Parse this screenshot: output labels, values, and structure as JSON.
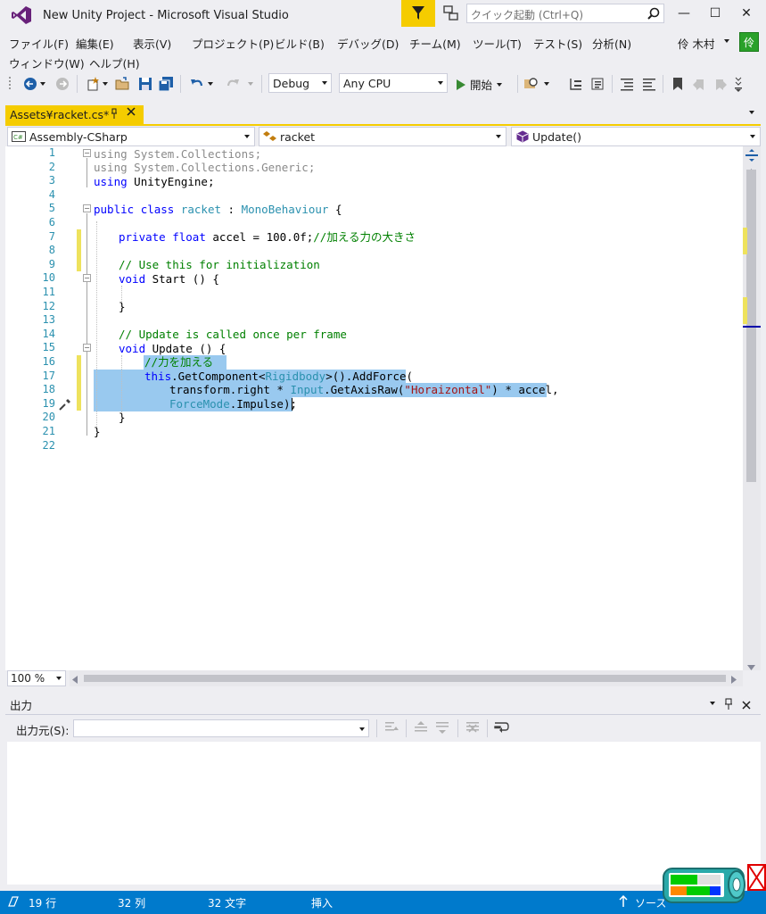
{
  "window": {
    "title": "New Unity Project - Microsoft Visual Studio",
    "quick_launch_placeholder": "クイック起動 (Ctrl+Q)",
    "minimize_glyph": "—",
    "maximize_glyph": "☐",
    "close_glyph": "✕"
  },
  "menu": {
    "items": [
      "ファイル(F)",
      "編集(E)",
      "表示(V)",
      "プロジェクト(P)",
      "ビルド(B)",
      "デバッグ(D)",
      "チーム(M)",
      "ツール(T)",
      "テスト(S)",
      "分析(N)",
      "ウィンドウ(W)",
      "ヘルプ(H)"
    ],
    "user_name": "伶 木村",
    "user_avatar_letter": "伶"
  },
  "toolbar": {
    "config": "Debug",
    "platform": "Any CPU",
    "start_label": "開始"
  },
  "tab": {
    "label": "Assets¥racket.cs*"
  },
  "navbar": {
    "project": "Assembly-CSharp",
    "type": "racket",
    "member": "Update()"
  },
  "editor": {
    "zoom": "100 %",
    "line_numbers": [
      "1",
      "2",
      "3",
      "4",
      "5",
      "6",
      "7",
      "8",
      "9",
      "10",
      "11",
      "12",
      "13",
      "14",
      "15",
      "16",
      "17",
      "18",
      "19",
      "20",
      "21",
      "22"
    ]
  },
  "code": {
    "l1": [
      "using",
      " System.Collections;"
    ],
    "l2": [
      "using",
      " System.Collections.Generic;"
    ],
    "l3": [
      "using",
      " UnityEngine;"
    ],
    "l5": [
      "public",
      " ",
      "class",
      " ",
      "racket",
      " : ",
      "MonoBehaviour",
      " {"
    ],
    "l7": [
      "private",
      " ",
      "float",
      " accel = 100.0f;",
      "//加える力の大きさ"
    ],
    "l9": [
      "// Use this for initialization"
    ],
    "l10": [
      "void",
      " Start () {"
    ],
    "l12": [
      "}"
    ],
    "l14": [
      "// Update is called once per frame"
    ],
    "l15": [
      "void",
      " Update () {"
    ],
    "l16": [
      "//力を加える"
    ],
    "l17": [
      "this",
      ".GetComponent<",
      "Rigidbody",
      ">().AddForce("
    ],
    "l18": [
      "transform.right * ",
      "Input",
      ".GetAxisRaw(",
      "\"Horaizontal\"",
      ") * accel,"
    ],
    "l19": [
      "ForceMode",
      ".Impulse);"
    ],
    "l20": [
      "}"
    ],
    "l21": [
      "}"
    ]
  },
  "output": {
    "title": "出力",
    "source_label": "出力元(S):",
    "source_value": ""
  },
  "status": {
    "line": "19 行",
    "col": "32 列",
    "char": "32 文字",
    "mode": "挿入",
    "source_control": "ソース"
  },
  "colors": {
    "accent": "#007acc",
    "tab_active": "#f5cc00",
    "selection": "#99c9ef",
    "change_bar": "#eee25d",
    "keyword": "#0000ff",
    "type": "#2b91af",
    "comment": "#008000",
    "string": "#a31515"
  }
}
